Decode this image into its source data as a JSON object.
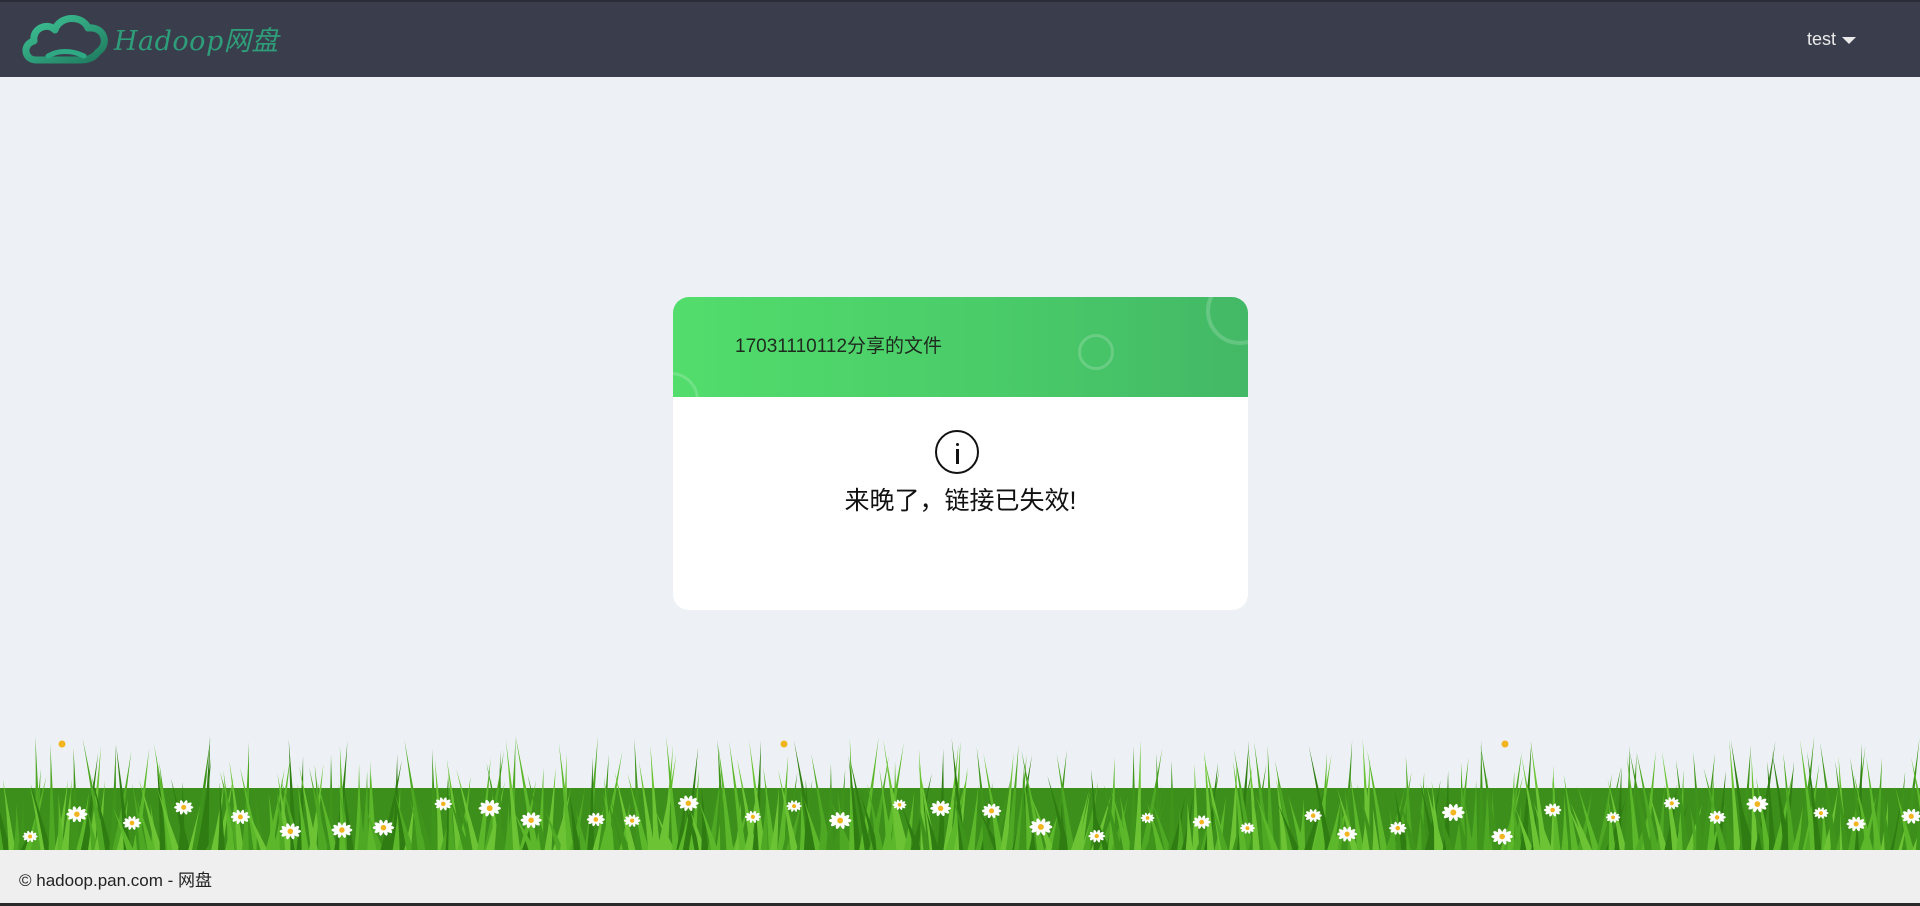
{
  "header": {
    "logo_text": "Hadoop网盘",
    "logo_icon": "cloud-icon",
    "user_name": "test",
    "brand_color": "#2e9e7a",
    "bar_color": "#3a3e4c"
  },
  "share": {
    "title": "17031110112分享的文件",
    "status_icon": "info-icon",
    "message": "来晚了，链接已失效!",
    "header_color": "#4ed26a"
  },
  "footer": {
    "copyright": "© hadoop.pan.com - 网盘"
  }
}
